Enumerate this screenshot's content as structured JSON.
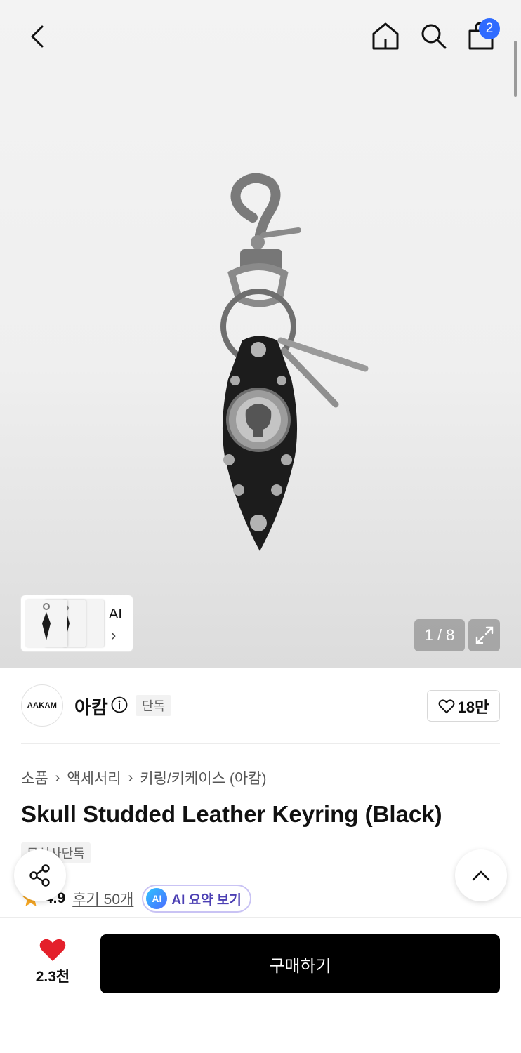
{
  "header": {
    "cart_count": "2"
  },
  "gallery": {
    "thumb_label": "AI",
    "counter": "1 / 8"
  },
  "brand": {
    "logo_text": "AAKAM",
    "name": "아캄",
    "tag": "단독",
    "like_count": "18만"
  },
  "breadcrumb": [
    "소품",
    "액세서리",
    "키링/키케이스 (아캄)"
  ],
  "product": {
    "title": "Skull Studded Leather Keyring (Black)",
    "exclusive_tag": "무신사단독",
    "rating": "4.9",
    "review_link": "후기 50개",
    "ai_summary_label": "AI 요약 보기",
    "ai_badge": "AI"
  },
  "bottom": {
    "like_count": "2.3천",
    "buy_label": "구매하기"
  },
  "colors": {
    "accent_blue": "#2f6bff",
    "heart_red": "#e4202b",
    "star": "#f5a623"
  }
}
